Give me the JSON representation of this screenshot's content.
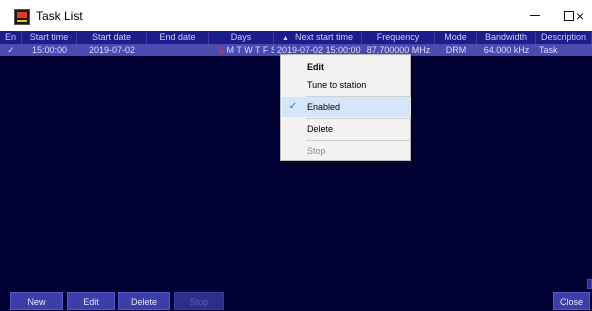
{
  "window": {
    "title": "Task List"
  },
  "window_buttons": {
    "minimize": "—",
    "maximize": "",
    "close": "×"
  },
  "table": {
    "columns": [
      "En",
      "Start time",
      "Start date",
      "End date",
      "Days",
      "Next start time",
      "Frequency",
      "Mode",
      "Bandwidth",
      "Description"
    ],
    "sort_indicator": "▲",
    "rows": [
      {
        "enabled": "✓",
        "start_time": "15:00:00",
        "start_date": "2019-07-02",
        "end_date": "",
        "days_first": "S",
        "days_rest": "M T W T F S",
        "next_start_time": "2019-07-02 15:00:00",
        "frequency": "87.700000 MHz",
        "mode": "DRM",
        "bandwidth": "64.000 kHz",
        "description": "Task"
      }
    ]
  },
  "buttons": {
    "new": "New",
    "edit": "Edit",
    "delete": "Delete",
    "stop": "Stop",
    "close": "Close"
  },
  "context_menu": {
    "items": [
      {
        "label": "Edit",
        "bold": true
      },
      {
        "label": "Tune to station"
      },
      {
        "label": "Enabled",
        "checked": true,
        "check": "✓"
      },
      {
        "label": "Delete"
      },
      {
        "label": "Stop",
        "disabled": true
      }
    ]
  },
  "colors": {
    "table_background": "#000033",
    "header_background": "#1c1c8a",
    "selected_row": "#4a4ab0",
    "button": "#3e3eaa",
    "sunday_marker": "#ff3030"
  }
}
